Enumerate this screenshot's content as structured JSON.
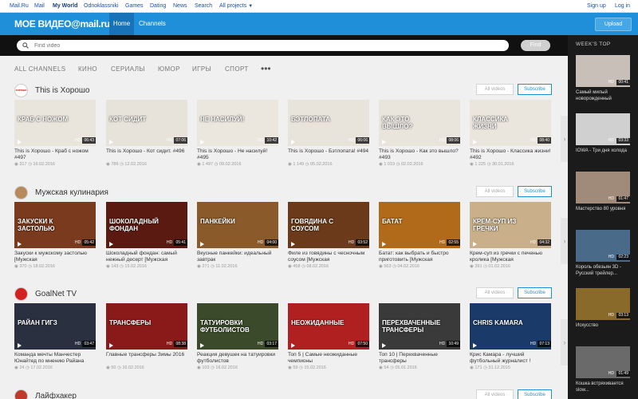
{
  "topbar": {
    "links": [
      "Mail.Ru",
      "Mail",
      "My World",
      "Odnoklassniki",
      "Games",
      "Dating",
      "News",
      "Search",
      "All projects"
    ],
    "signup": "Sign up",
    "login": "Log in"
  },
  "header": {
    "logo": "МОЕ ВИДЕО@mail.ru",
    "nav_home": "Home",
    "nav_channels": "Channels",
    "upload": "Upload"
  },
  "search": {
    "placeholder": "Find video",
    "button": "Find"
  },
  "categories": [
    "ALL CHANNELS",
    "КИНО",
    "СЕРИАЛЫ",
    "ЮМОР",
    "ИГРЫ",
    "СПОРТ"
  ],
  "categories_more": "•••",
  "sections": [
    {
      "title": "This is Хорошо",
      "icon_label": "ХОРОШО",
      "all_videos": "All videos",
      "subscribe": "Subscribe",
      "videos": [
        {
          "title": "This is Хорошо - Краб с ножом #497",
          "views": "317",
          "date": "16.02.2016",
          "duration": "06:43",
          "overlay": "КРАБ С НОЖОМ",
          "bg": "#e9e4dc"
        },
        {
          "title": "This is Хорошо - Кот сидит. #496",
          "views": "786",
          "date": "12.02.2016",
          "duration": "07:06",
          "overlay": "КОТ СИДИТ",
          "bg": "#e7e2da"
        },
        {
          "title": "This is Хорошо - Не насилуй! #495",
          "views": "1 497",
          "date": "09.02.2016",
          "duration": "10:42",
          "overlay": "НЕ НАСИЛУЙ!",
          "bg": "#ebe6de"
        },
        {
          "title": "This is Хорошо - Бэтлопата! #494",
          "views": "1 149",
          "date": "05.02.2016",
          "duration": "06:06",
          "overlay": "БЭТЛОПАТА",
          "bg": "#e8e3db"
        },
        {
          "title": "This is Хорошо - Как это вышло? #493",
          "views": "1 019",
          "date": "02.02.2016",
          "duration": "08:06",
          "overlay": "КАК ЭТО ВЫШЛО?",
          "bg": "#e9e4dc"
        },
        {
          "title": "This is Хорошо - Классика жизни! #492",
          "views": "1 225",
          "date": "30.01.2016",
          "duration": "08:40",
          "overlay": "КЛАССИКА ЖИЗНИ",
          "bg": "#eae5dd"
        }
      ]
    },
    {
      "title": "Мужская кулинария",
      "icon_label": "",
      "all_videos": "All videos",
      "subscribe": "Subscribe",
      "videos": [
        {
          "title": "Закуски к мужскому застолью [Мужская",
          "views": "370",
          "date": "18.02.2016",
          "duration": "05:42",
          "overlay": "ЗАКУСКИ К ЗАСТОЛЬЮ",
          "bg": "#7a3a1e"
        },
        {
          "title": "Шоколадный фондан: самый нежный десерт [Мужская",
          "views": "143",
          "date": "15.02.2016",
          "duration": "05:41",
          "overlay": "ШОКОЛАДНЫЙ ФОНДАН",
          "bg": "#5a1a12"
        },
        {
          "title": "Вкусные панкейки: идеальный завтрак",
          "views": "271",
          "date": "11.02.2016",
          "duration": "04:00",
          "overlay": "ПАНКЕЙКИ",
          "bg": "#8a5a2a"
        },
        {
          "title": "Филе из говядины с чесночным соусом [Мужская",
          "views": "458",
          "date": "08.02.2016",
          "duration": "03:52",
          "overlay": "ГОВЯДИНА С СОУСОМ",
          "bg": "#6a3a1a"
        },
        {
          "title": "Батат: как выбрать и быстро приготовить [Мужская",
          "views": "563",
          "date": "04.02.2016",
          "duration": "02:55",
          "overlay": "БАТАТ",
          "bg": "#b06a1a"
        },
        {
          "title": "Крем-суп из гречки с печенью кролика [Мужская",
          "views": "391",
          "date": "01.02.2016",
          "duration": "04:32",
          "overlay": "КРЕМ-СУП ИЗ ГРЕЧКИ",
          "bg": "#c9b08a"
        }
      ]
    },
    {
      "title": "GoalNet TV",
      "icon_label": "",
      "all_videos": "All videos",
      "subscribe": "Subscribe",
      "videos": [
        {
          "title": "Команда мечты Манчестер Юнайтед по мнению Райана",
          "views": "24",
          "date": "17.02.2016",
          "duration": "03:47",
          "overlay": "РАЙАН ГИГЗ",
          "bg": "#2a3040"
        },
        {
          "title": "Главные трансферы Зимы 2016",
          "views": "50",
          "date": "16.02.2016",
          "duration": "08:38",
          "overlay": "ТРАНСФЕРЫ",
          "bg": "#8a1a1a"
        },
        {
          "title": "Реакция девушек на татуировки футболистов",
          "views": "103",
          "date": "16.02.2016",
          "duration": "03:17",
          "overlay": "ТАТУИРОВКИ ФУТБОЛИСТОВ",
          "bg": "#3a4a2a"
        },
        {
          "title": "Топ 5 | Самые неожиданные чемпионы",
          "views": "59",
          "date": "15.02.2016",
          "duration": "07:50",
          "overlay": "НЕОЖИДАННЫЕ",
          "bg": "#b02020"
        },
        {
          "title": "Топ 10 | Перехваченные трансферы",
          "views": "54",
          "date": "05.01.2016",
          "duration": "10:49",
          "overlay": "ПЕРЕХВАЧЕННЫЕ ТРАНСФЕРЫ",
          "bg": "#3a3a3a"
        },
        {
          "title": "Крис Камара - лучший футбольный журналист !",
          "views": "171",
          "date": "31.12.2015",
          "duration": "07:13",
          "overlay": "CHRIS KAMARA",
          "bg": "#1a3a6a"
        }
      ]
    },
    {
      "title": "Лайфхакер",
      "icon_label": "",
      "all_videos": "All videos",
      "subscribe": "Subscribe",
      "videos": []
    }
  ],
  "hd_label": "HD",
  "sidebar": {
    "title": "WEEK'S TOP",
    "items": [
      {
        "caption": "Самый милый новорожденный",
        "duration": "00:41",
        "bg": "#c8c0b8"
      },
      {
        "caption": "IOWA - Три дня холода",
        "duration": "03:33",
        "bg": "#d0d0d0"
      },
      {
        "caption": "Мастерство 80 уровня",
        "duration": "01:47",
        "bg": "#a08a7a"
      },
      {
        "caption": "Король обезьян 3D - Русский трейлер...",
        "duration": "02:23",
        "bg": "#4a6a8a"
      },
      {
        "caption": "Искусство",
        "duration": "03:13",
        "bg": "#8a6a2a"
      },
      {
        "caption": "Кошка встряхивается slow...",
        "duration": "01:49",
        "bg": "#6a6a6a"
      }
    ]
  },
  "colors": {
    "accent": "#1e8fd8",
    "header_active": "#1772b8"
  }
}
